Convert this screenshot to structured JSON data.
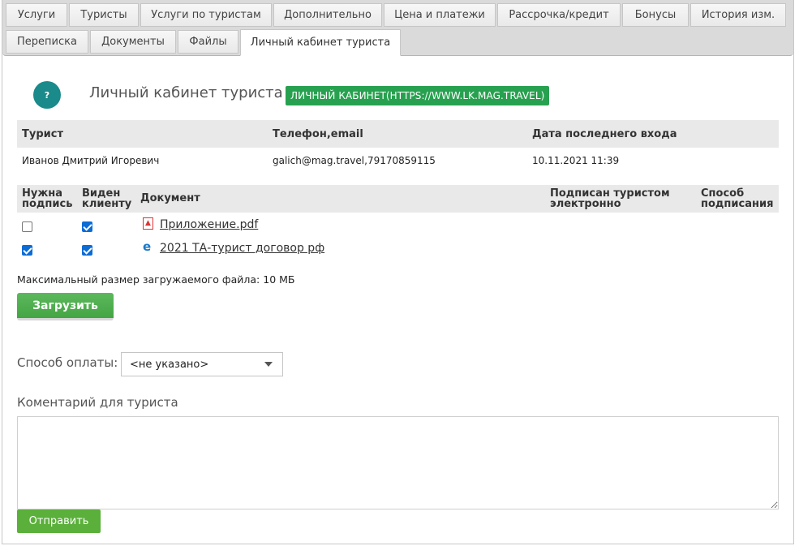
{
  "tabs": [
    {
      "label": "Услуги"
    },
    {
      "label": "Туристы"
    },
    {
      "label": "Услуги по туристам"
    },
    {
      "label": "Дополнительно"
    },
    {
      "label": "Цена и платежи"
    },
    {
      "label": "Рассрочка/кредит"
    },
    {
      "label": "Бонусы"
    },
    {
      "label": "История изм."
    },
    {
      "label": "Переписка"
    },
    {
      "label": "Документы"
    },
    {
      "label": "Файлы"
    },
    {
      "label": "Личный кабинет туриста"
    }
  ],
  "header": {
    "help_symbol": "?",
    "title": "Личный кабинет туриста",
    "lk_link": "ЛИЧНЫЙ КАБИНЕТ(HTTPS://WWW.LK.MAG.TRAVEL)"
  },
  "tourist_table": {
    "headers": [
      "Турист",
      "Телефон,email",
      "Дата последнего входа"
    ],
    "row": [
      "Иванов Дмитрий Игоревич",
      "galich@mag.travel,79170859115",
      "10.11.2021 11:39"
    ]
  },
  "docs_table": {
    "headers": {
      "need_sign_1": "Нужна",
      "need_sign_2": "подпись",
      "visible_1": "Виден",
      "visible_2": "клиенту",
      "document": "Документ",
      "signed_1": "Подписан туристом",
      "signed_2": "электронно",
      "method_1": "Способ",
      "method_2": "подписания"
    },
    "rows": [
      {
        "need_sign": false,
        "visible": true,
        "icon": "pdf-icon",
        "name": "Приложение.pdf"
      },
      {
        "need_sign": true,
        "visible": true,
        "icon": "ie-document-icon",
        "name": "2021 ТА-турист договор рф"
      }
    ]
  },
  "upload": {
    "max_size_text": "Максимальный размер загружаемого файла: 10 МБ",
    "button_label": "Загрузить"
  },
  "payment": {
    "label": "Способ оплаты:",
    "selected": "<не указано>"
  },
  "comment": {
    "label": "Коментарий для туриста",
    "value": ""
  },
  "send_label": "Отправить",
  "colors": {
    "accent_green": "#27a14f",
    "help_teal": "#1a8a8a",
    "checkbox_blue": "#0b6cd6"
  }
}
